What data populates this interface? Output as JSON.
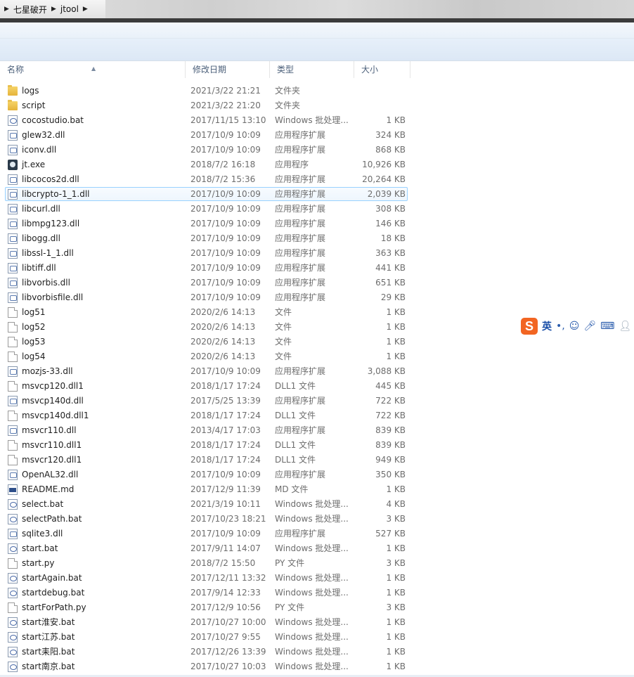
{
  "breadcrumb": {
    "items": [
      "七星破开",
      "jtool"
    ]
  },
  "columns": {
    "name": "名称",
    "date": "修改日期",
    "type": "类型",
    "size": "大小"
  },
  "files": [
    {
      "name": "logs",
      "date": "2021/3/22 21:21",
      "type": "文件夹",
      "size": "",
      "icon": "folder-icon"
    },
    {
      "name": "script",
      "date": "2021/3/22 21:20",
      "type": "文件夹",
      "size": "",
      "icon": "folder-icon"
    },
    {
      "name": "cocostudio.bat",
      "date": "2017/11/15 13:10",
      "type": "Windows 批处理...",
      "size": "1 KB",
      "icon": "bat-file-icon"
    },
    {
      "name": "glew32.dll",
      "date": "2017/10/9 10:09",
      "type": "应用程序扩展",
      "size": "324 KB",
      "icon": "dll-file-icon"
    },
    {
      "name": "iconv.dll",
      "date": "2017/10/9 10:09",
      "type": "应用程序扩展",
      "size": "868 KB",
      "icon": "dll-file-icon"
    },
    {
      "name": "jt.exe",
      "date": "2018/7/2 16:18",
      "type": "应用程序",
      "size": "10,926 KB",
      "icon": "exe-file-icon"
    },
    {
      "name": "libcocos2d.dll",
      "date": "2018/7/2 15:36",
      "type": "应用程序扩展",
      "size": "20,264 KB",
      "icon": "dll-file-icon"
    },
    {
      "name": "libcrypto-1_1.dll",
      "date": "2017/10/9 10:09",
      "type": "应用程序扩展",
      "size": "2,039 KB",
      "icon": "dll-file-icon",
      "selected": true
    },
    {
      "name": "libcurl.dll",
      "date": "2017/10/9 10:09",
      "type": "应用程序扩展",
      "size": "308 KB",
      "icon": "dll-file-icon"
    },
    {
      "name": "libmpg123.dll",
      "date": "2017/10/9 10:09",
      "type": "应用程序扩展",
      "size": "146 KB",
      "icon": "dll-file-icon"
    },
    {
      "name": "libogg.dll",
      "date": "2017/10/9 10:09",
      "type": "应用程序扩展",
      "size": "18 KB",
      "icon": "dll-file-icon"
    },
    {
      "name": "libssl-1_1.dll",
      "date": "2017/10/9 10:09",
      "type": "应用程序扩展",
      "size": "363 KB",
      "icon": "dll-file-icon"
    },
    {
      "name": "libtiff.dll",
      "date": "2017/10/9 10:09",
      "type": "应用程序扩展",
      "size": "441 KB",
      "icon": "dll-file-icon"
    },
    {
      "name": "libvorbis.dll",
      "date": "2017/10/9 10:09",
      "type": "应用程序扩展",
      "size": "651 KB",
      "icon": "dll-file-icon"
    },
    {
      "name": "libvorbisfile.dll",
      "date": "2017/10/9 10:09",
      "type": "应用程序扩展",
      "size": "29 KB",
      "icon": "dll-file-icon"
    },
    {
      "name": "log51",
      "date": "2020/2/6 14:13",
      "type": "文件",
      "size": "1 KB",
      "icon": "blank-file-icon"
    },
    {
      "name": "log52",
      "date": "2020/2/6 14:13",
      "type": "文件",
      "size": "1 KB",
      "icon": "blank-file-icon"
    },
    {
      "name": "log53",
      "date": "2020/2/6 14:13",
      "type": "文件",
      "size": "1 KB",
      "icon": "blank-file-icon"
    },
    {
      "name": "log54",
      "date": "2020/2/6 14:13",
      "type": "文件",
      "size": "1 KB",
      "icon": "blank-file-icon"
    },
    {
      "name": "mozjs-33.dll",
      "date": "2017/10/9 10:09",
      "type": "应用程序扩展",
      "size": "3,088 KB",
      "icon": "dll-file-icon"
    },
    {
      "name": "msvcp120.dll1",
      "date": "2018/1/17 17:24",
      "type": "DLL1 文件",
      "size": "445 KB",
      "icon": "blank-file-icon"
    },
    {
      "name": "msvcp140d.dll",
      "date": "2017/5/25 13:39",
      "type": "应用程序扩展",
      "size": "722 KB",
      "icon": "dll-file-icon"
    },
    {
      "name": "msvcp140d.dll1",
      "date": "2018/1/17 17:24",
      "type": "DLL1 文件",
      "size": "722 KB",
      "icon": "blank-file-icon"
    },
    {
      "name": "msvcr110.dll",
      "date": "2013/4/17 17:03",
      "type": "应用程序扩展",
      "size": "839 KB",
      "icon": "dll-file-icon"
    },
    {
      "name": "msvcr110.dll1",
      "date": "2018/1/17 17:24",
      "type": "DLL1 文件",
      "size": "839 KB",
      "icon": "blank-file-icon"
    },
    {
      "name": "msvcr120.dll1",
      "date": "2018/1/17 17:24",
      "type": "DLL1 文件",
      "size": "949 KB",
      "icon": "blank-file-icon"
    },
    {
      "name": "OpenAL32.dll",
      "date": "2017/10/9 10:09",
      "type": "应用程序扩展",
      "size": "350 KB",
      "icon": "dll-file-icon"
    },
    {
      "name": "README.md",
      "date": "2017/12/9 11:39",
      "type": "MD 文件",
      "size": "1 KB",
      "icon": "md-file-icon"
    },
    {
      "name": "select.bat",
      "date": "2021/3/19 10:11",
      "type": "Windows 批处理...",
      "size": "4 KB",
      "icon": "bat-file-icon"
    },
    {
      "name": "selectPath.bat",
      "date": "2017/10/23 18:21",
      "type": "Windows 批处理...",
      "size": "3 KB",
      "icon": "bat-file-icon"
    },
    {
      "name": "sqlite3.dll",
      "date": "2017/10/9 10:09",
      "type": "应用程序扩展",
      "size": "527 KB",
      "icon": "dll-file-icon"
    },
    {
      "name": "start.bat",
      "date": "2017/9/11 14:07",
      "type": "Windows 批处理...",
      "size": "1 KB",
      "icon": "bat-file-icon"
    },
    {
      "name": "start.py",
      "date": "2018/7/2 15:50",
      "type": "PY 文件",
      "size": "3 KB",
      "icon": "blank-file-icon"
    },
    {
      "name": "startAgain.bat",
      "date": "2017/12/11 13:32",
      "type": "Windows 批处理...",
      "size": "1 KB",
      "icon": "bat-file-icon"
    },
    {
      "name": "startdebug.bat",
      "date": "2017/9/14 12:33",
      "type": "Windows 批处理...",
      "size": "1 KB",
      "icon": "bat-file-icon"
    },
    {
      "name": "startForPath.py",
      "date": "2017/12/9 10:56",
      "type": "PY 文件",
      "size": "3 KB",
      "icon": "blank-file-icon"
    },
    {
      "name": "start淮安.bat",
      "date": "2017/10/27 10:00",
      "type": "Windows 批处理...",
      "size": "1 KB",
      "icon": "bat-file-icon"
    },
    {
      "name": "start江苏.bat",
      "date": "2017/10/27 9:55",
      "type": "Windows 批处理...",
      "size": "1 KB",
      "icon": "bat-file-icon"
    },
    {
      "name": "start耒阳.bat",
      "date": "2017/12/26 13:39",
      "type": "Windows 批处理...",
      "size": "1 KB",
      "icon": "bat-file-icon"
    },
    {
      "name": "start南京.bat",
      "date": "2017/10/27 10:03",
      "type": "Windows 批处理...",
      "size": "1 KB",
      "icon": "bat-file-icon"
    }
  ],
  "ime": {
    "logo": "S",
    "lang": "英",
    "punct": "•,",
    "icons": [
      "smiley-icon",
      "microphone-icon",
      "keyboard-icon",
      "user-icon"
    ]
  }
}
